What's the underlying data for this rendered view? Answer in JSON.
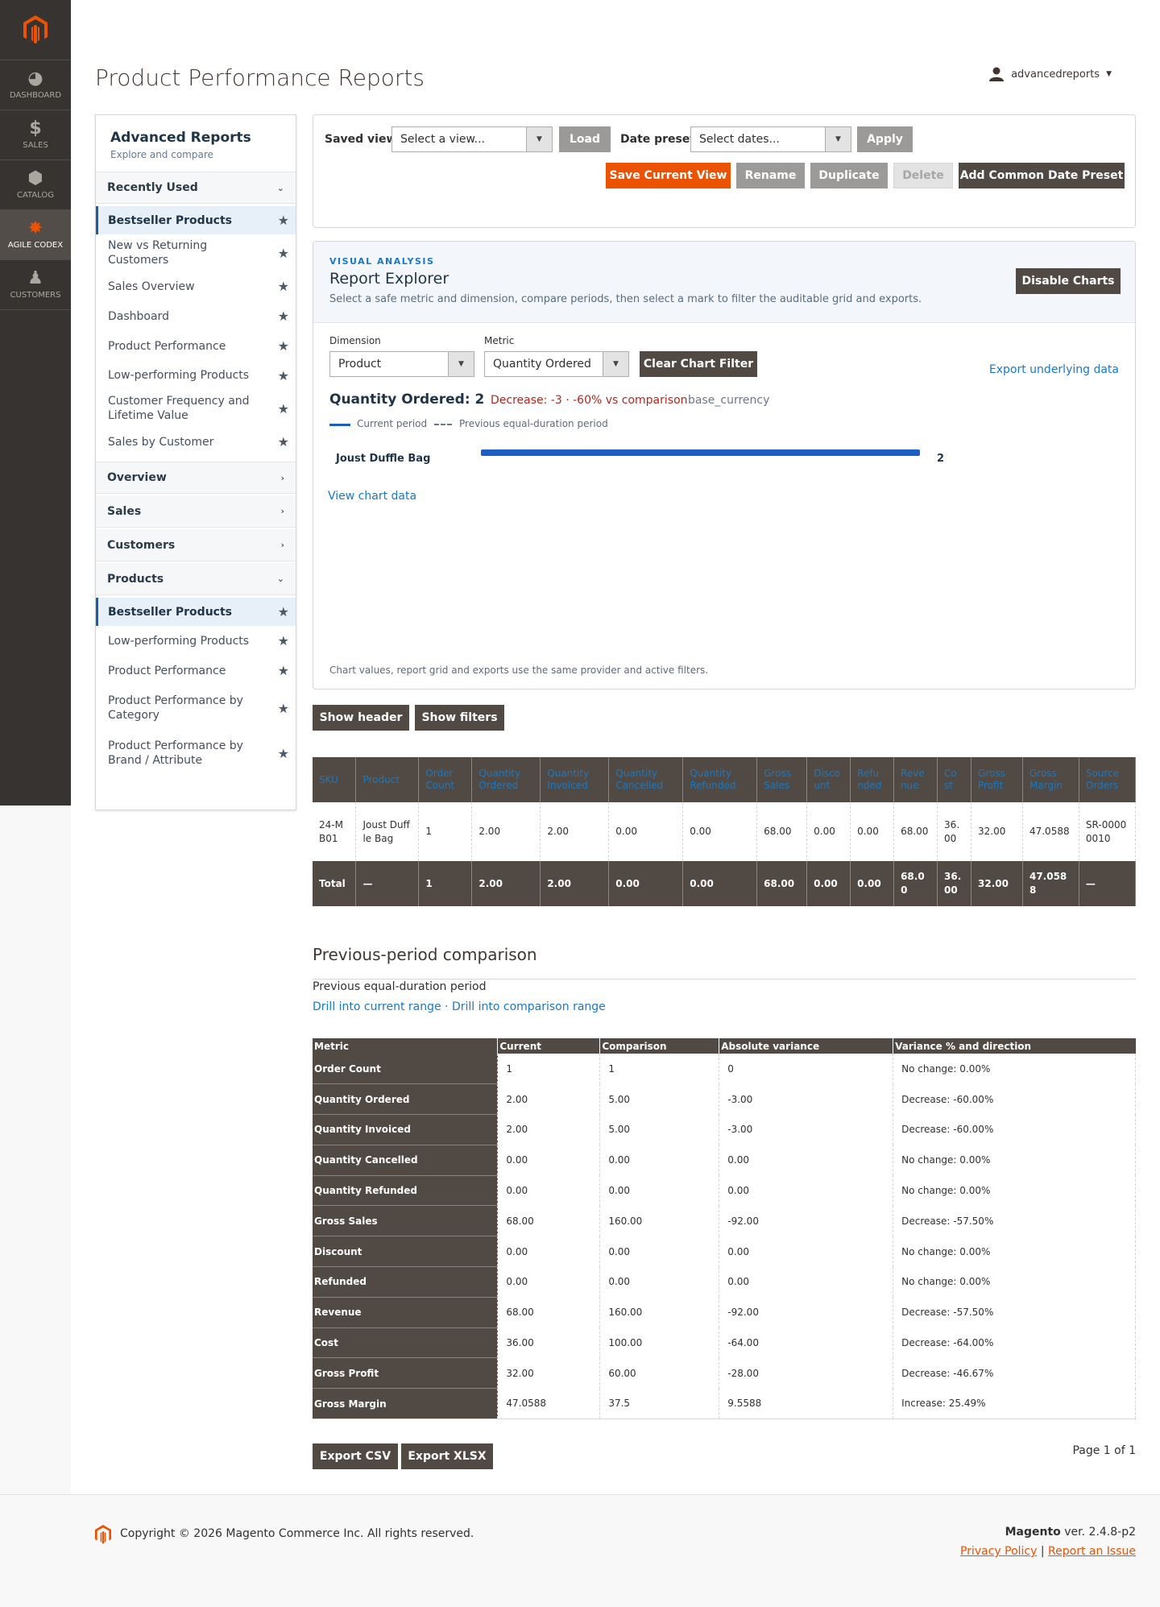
{
  "nav": {
    "items": [
      {
        "label": "DASHBOARD",
        "icon": "dashboard-icon"
      },
      {
        "label": "SALES",
        "icon": "dollar-icon"
      },
      {
        "label": "CATALOG",
        "icon": "box-icon"
      },
      {
        "label": "AGILE CODEX",
        "icon": "codex-icon"
      },
      {
        "label": "CUSTOMERS",
        "icon": "person-icon"
      }
    ]
  },
  "header": {
    "title": "Product Performance Reports",
    "user": "advancedreports"
  },
  "sidebar": {
    "title": "Advanced Reports",
    "subtitle": "Explore and compare",
    "recent_label": "Recently Used",
    "recent": [
      "Bestseller Products",
      "New vs Returning Customers",
      "Sales Overview",
      "Dashboard",
      "Product Performance",
      "Low-performing Products",
      "Customer Frequency and Lifetime Value",
      "Sales by Customer"
    ],
    "overview_label": "Overview",
    "sales_label": "Sales",
    "customers_label": "Customers",
    "products_label": "Products",
    "products": [
      "Bestseller Products",
      "Low-performing Products",
      "Product Performance",
      "Product Performance by Category",
      "Product Performance by Brand / Attribute"
    ]
  },
  "toolbar": {
    "saved_view_label": "Saved view",
    "saved_view_placeholder": "Select a view...",
    "load": "Load",
    "date_preset_label": "Date preset",
    "date_preset_placeholder": "Select dates...",
    "apply": "Apply",
    "save_current": "Save Current View",
    "rename": "Rename",
    "duplicate": "Duplicate",
    "delete": "Delete",
    "add_preset": "Add Common Date Preset"
  },
  "explorer": {
    "eyebrow": "VISUAL ANALYSIS",
    "title": "Report Explorer",
    "desc": "Select a safe metric and dimension, compare periods, then select a mark to filter the auditable grid and exports.",
    "disable": "Disable Charts",
    "dimension_label": "Dimension",
    "dimension_value": "Product",
    "metric_label": "Metric",
    "metric_value": "Quantity Ordered",
    "clear_filter": "Clear Chart Filter",
    "export_link": "Export underlying data",
    "summary": "Quantity Ordered: 2",
    "change": "Decrease: -3 · -60% vs comparison",
    "currency": "base_currency",
    "legend_current": "Current period",
    "legend_previous": "Previous equal-duration period",
    "view_chart_data": "View chart data",
    "footnote": "Chart values, report grid and exports use the same provider and active filters."
  },
  "chart_data": {
    "type": "bar",
    "categories": [
      "Joust Duffle Bag"
    ],
    "series": [
      {
        "name": "Current period",
        "values": [
          2
        ]
      }
    ],
    "value_labels": [
      "2"
    ],
    "xlim": [
      0,
      2
    ]
  },
  "buttons": {
    "show_header": "Show header",
    "show_filters": "Show filters"
  },
  "grid": {
    "columns": [
      "SKU",
      "Product",
      "Order Count",
      "Quantity Ordered",
      "Quantity Invoiced",
      "Quantity Cancelled",
      "Quantity Refunded",
      "Gross Sales",
      "Disco unt",
      "Refu nded",
      "Reve nue",
      "Co st",
      "Gross Profit",
      "Gross Margin",
      "Source Orders"
    ],
    "rows": [
      [
        "24-MB01",
        "Joust Duffle Bag",
        "1",
        "2.00",
        "2.00",
        "0.00",
        "0.00",
        "68.00",
        "0.00",
        "0.00",
        "68.00",
        "36.00",
        "32.00",
        "47.0588",
        "SR-00000010"
      ]
    ],
    "total": [
      "Total",
      "—",
      "1",
      "2.00",
      "2.00",
      "0.00",
      "0.00",
      "68.00",
      "0.00",
      "0.00",
      "68.00",
      "36.00",
      "32.00",
      "47.0588",
      "—"
    ]
  },
  "comparison": {
    "title": "Previous-period comparison",
    "subtitle": "Previous equal-duration period",
    "drill_current": "Drill into current range",
    "sep": " · ",
    "drill_comparison": "Drill into comparison range",
    "columns": [
      "Metric",
      "Current",
      "Comparison",
      "Absolute variance",
      "Variance % and direction"
    ],
    "rows": [
      [
        "Order Count",
        "1",
        "1",
        "0",
        "No change: 0.00%"
      ],
      [
        "Quantity Ordered",
        "2.00",
        "5.00",
        "-3.00",
        "Decrease: -60.00%"
      ],
      [
        "Quantity Invoiced",
        "2.00",
        "5.00",
        "-3.00",
        "Decrease: -60.00%"
      ],
      [
        "Quantity Cancelled",
        "0.00",
        "0.00",
        "0.00",
        "No change: 0.00%"
      ],
      [
        "Quantity Refunded",
        "0.00",
        "0.00",
        "0.00",
        "No change: 0.00%"
      ],
      [
        "Gross Sales",
        "68.00",
        "160.00",
        "-92.00",
        "Decrease: -57.50%"
      ],
      [
        "Discount",
        "0.00",
        "0.00",
        "0.00",
        "No change: 0.00%"
      ],
      [
        "Refunded",
        "0.00",
        "0.00",
        "0.00",
        "No change: 0.00%"
      ],
      [
        "Revenue",
        "68.00",
        "160.00",
        "-92.00",
        "Decrease: -57.50%"
      ],
      [
        "Cost",
        "36.00",
        "100.00",
        "-64.00",
        "Decrease: -64.00%"
      ],
      [
        "Gross Profit",
        "32.00",
        "60.00",
        "-28.00",
        "Decrease: -46.67%"
      ],
      [
        "Gross Margin",
        "47.0588",
        "37.5",
        "9.5588",
        "Increase: 25.49%"
      ]
    ]
  },
  "export": {
    "csv": "Export CSV",
    "xlsx": "Export XLSX",
    "page": "Page 1 of 1"
  },
  "footer": {
    "copyright": "Copyright © 2026 Magento Commerce Inc. All rights reserved.",
    "brand": "Magento",
    "version": " ver. 2.4.8-p2",
    "privacy": "Privacy Policy",
    "divider": "|",
    "report": "Report an Issue"
  },
  "colors": {
    "accent": "#eb5202",
    "dark": "#514943",
    "link": "#1979c3",
    "bar": "#1c5fc4",
    "decrease": "#b3261e"
  }
}
